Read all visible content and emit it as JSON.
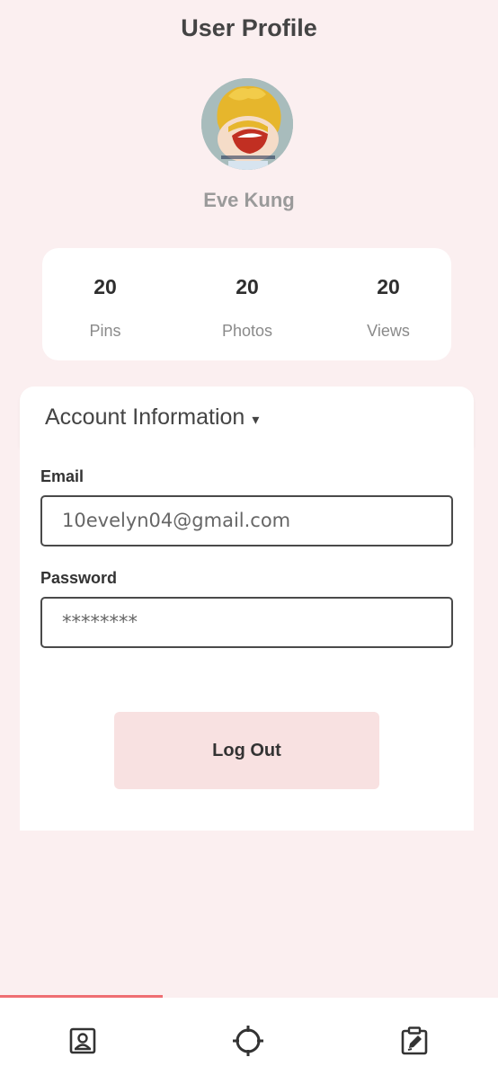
{
  "header": {
    "title": "User Profile"
  },
  "profile": {
    "name": "Eve Kung",
    "avatar_icon": "avatar-cartoon-image"
  },
  "stats": [
    {
      "value": "20",
      "label": "Pins"
    },
    {
      "value": "20",
      "label": "Photos"
    },
    {
      "value": "20",
      "label": "Views"
    }
  ],
  "account": {
    "title": "Account Information",
    "caret": "▾",
    "email_label": "Email",
    "email_value": "10evelyn04@gmail.com",
    "password_label": "Password",
    "password_value": "********",
    "logout_label": "Log Out"
  },
  "bottom_nav": {
    "items": [
      {
        "icon": "profile-icon",
        "active": true
      },
      {
        "icon": "crosshair-icon",
        "active": false
      },
      {
        "icon": "edit-clipboard-icon",
        "active": false
      }
    ],
    "active_color": "#ef6f73"
  },
  "colors": {
    "background": "#fbeff0",
    "button": "#f8e1e1",
    "accent": "#ef6f73"
  }
}
